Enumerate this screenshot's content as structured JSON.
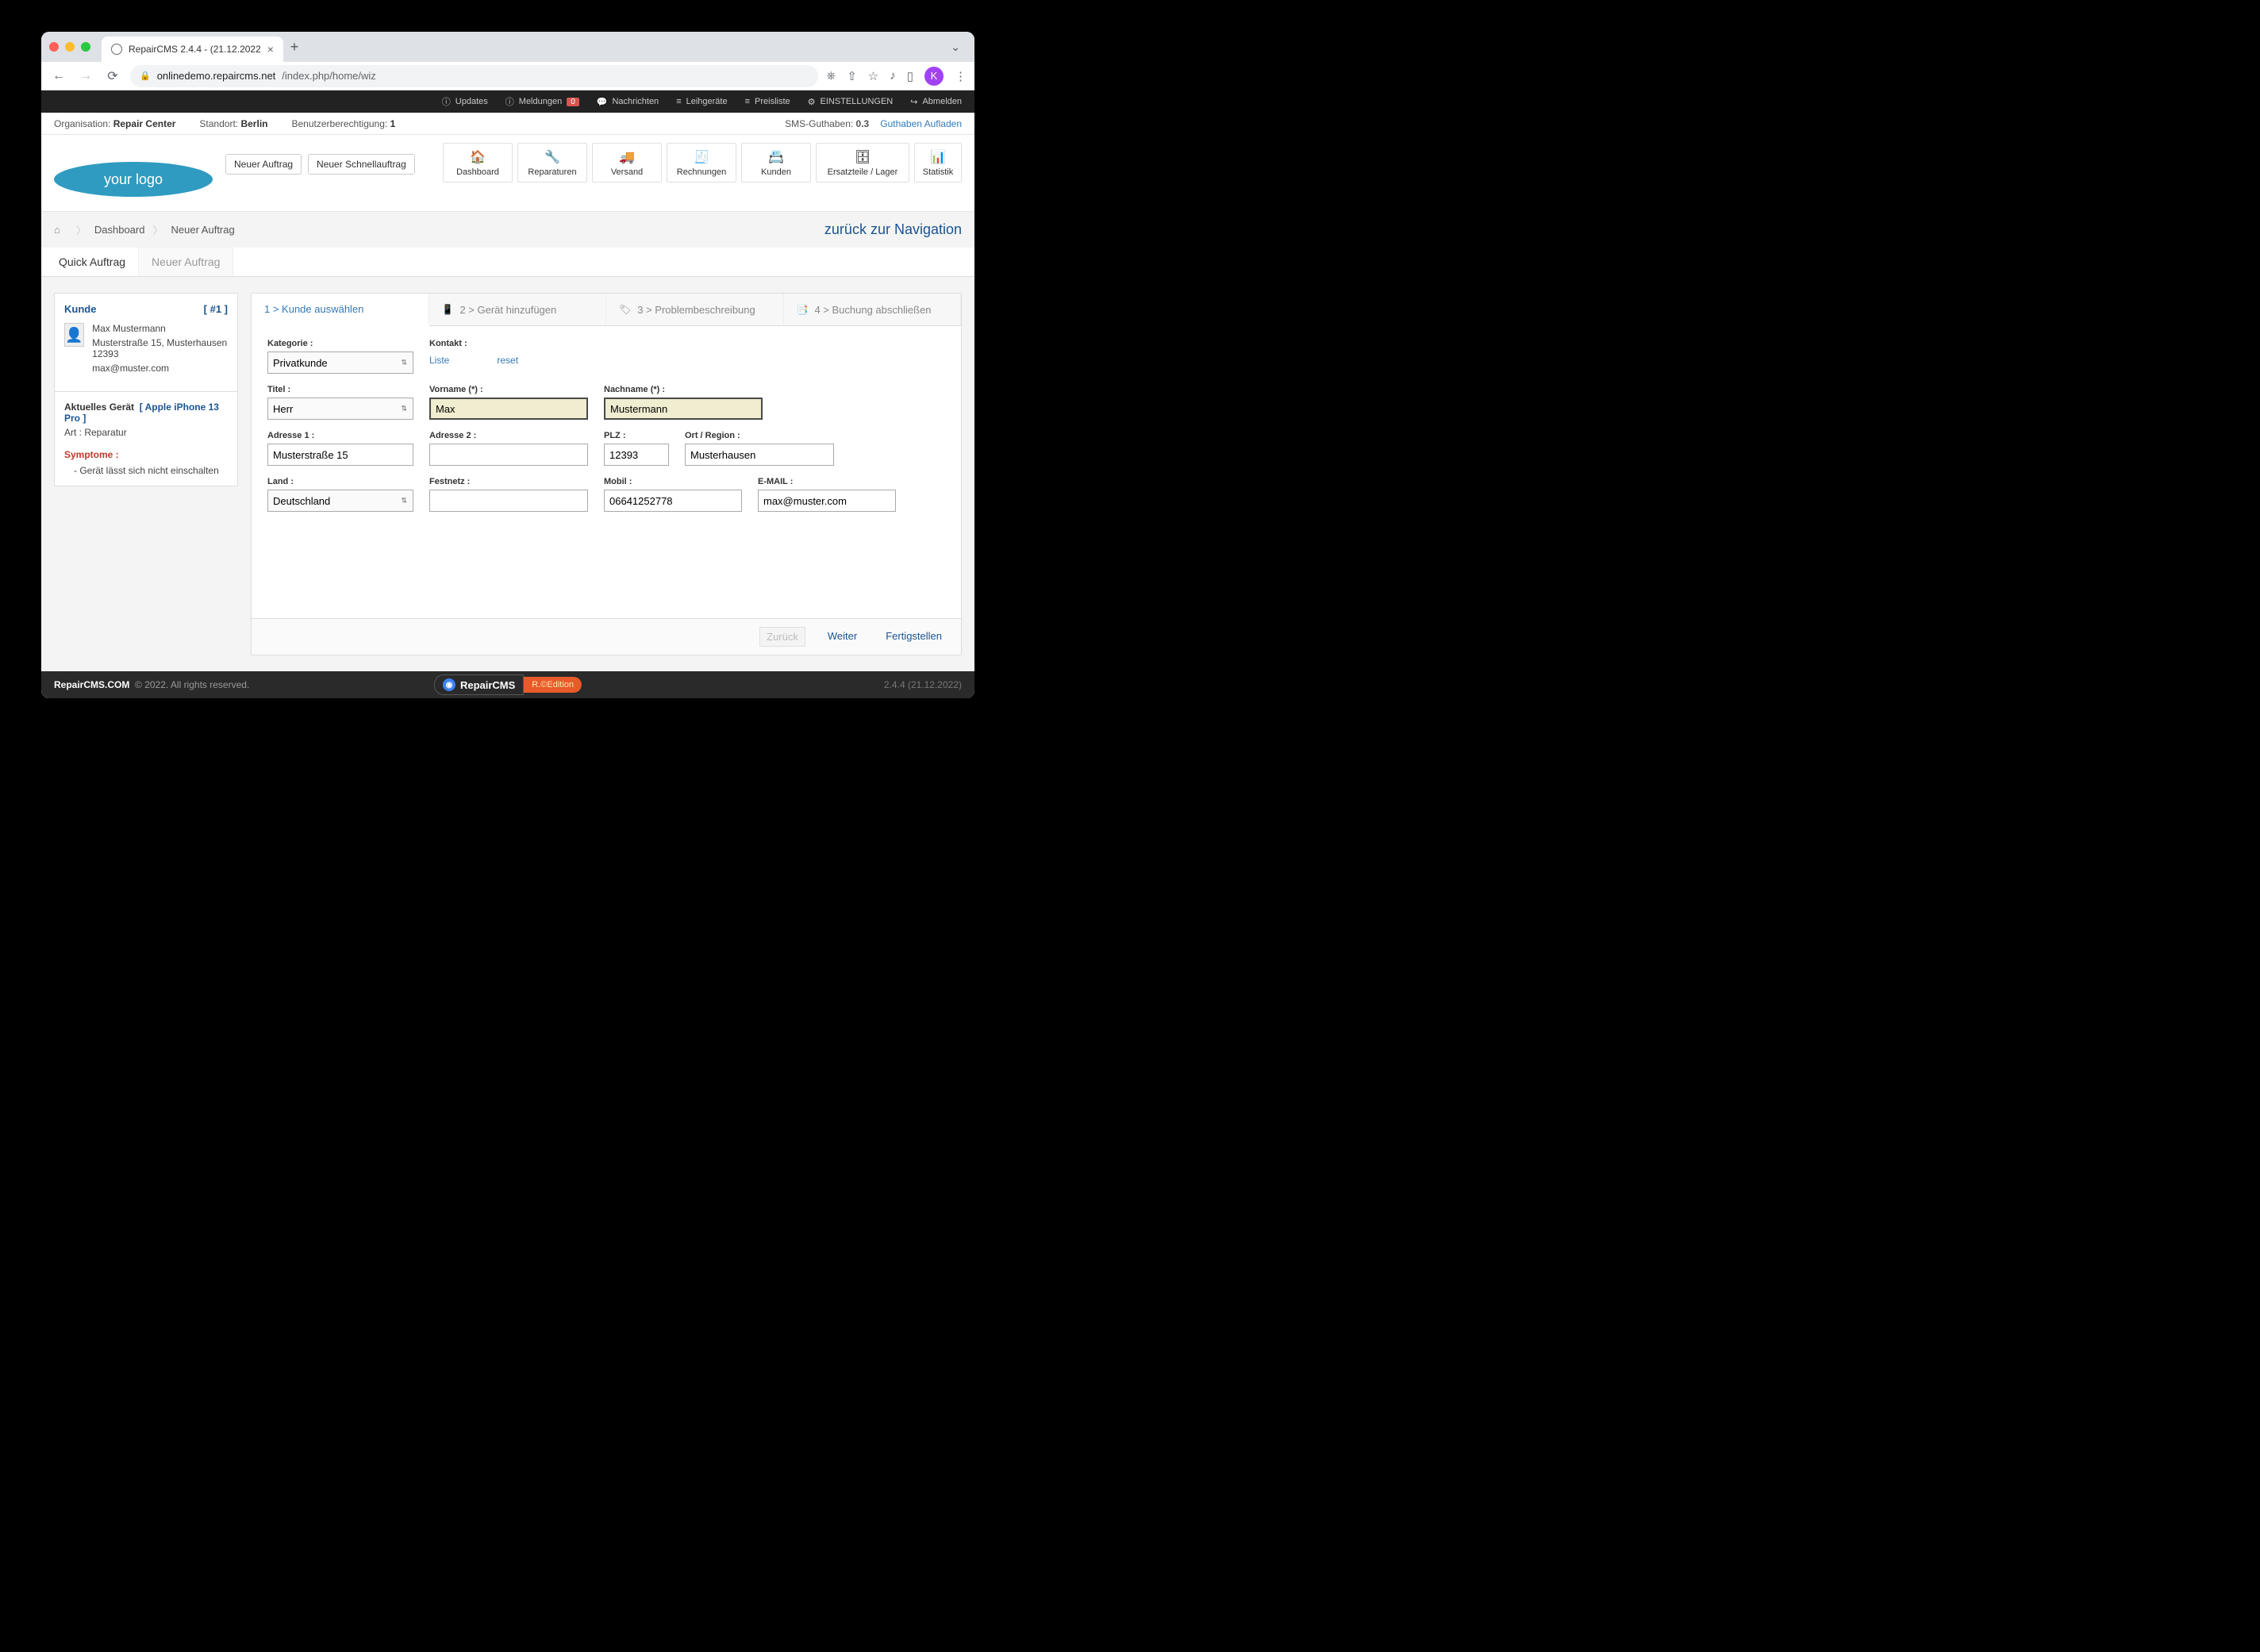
{
  "browser": {
    "tab_title": "RepairCMS 2.4.4 - (21.12.2022",
    "url_domain": "onlinedemo.repaircms.net",
    "url_path": "/index.php/home/wiz",
    "avatar_letter": "K"
  },
  "topbar": {
    "updates": "Updates",
    "meldungen": "Meldungen",
    "meldungen_badge": "0",
    "nachrichten": "Nachrichten",
    "leihgeraete": "Leihgeräte",
    "preisliste": "Preisliste",
    "einstellungen": "EINSTELLUNGEN",
    "abmelden": "Abmelden"
  },
  "infobar": {
    "org_label": "Organisation:",
    "org_value": "Repair Center",
    "loc_label": "Standort:",
    "loc_value": "Berlin",
    "perm_label": "Benutzerberechtigung:",
    "perm_value": "1",
    "sms_label": "SMS-Guthaben:",
    "sms_value": "0.3",
    "topup": "Guthaben Aufladen"
  },
  "header": {
    "logo_text": "your logo",
    "btn_new_order": "Neuer Auftrag",
    "btn_quick_order": "Neuer Schnellauftrag",
    "nav": {
      "dashboard": "Dashboard",
      "reparaturen": "Reparaturen",
      "versand": "Versand",
      "rechnungen": "Rechnungen",
      "kunden": "Kunden",
      "ersatzteile": "Ersatzteile / Lager",
      "statistik": "Statistik"
    }
  },
  "breadcrumb": {
    "dashboard": "Dashboard",
    "current": "Neuer Auftrag",
    "back": "zurück zur Navigation"
  },
  "tabs": {
    "quick": "Quick Auftrag",
    "neu": "Neuer Auftrag"
  },
  "side": {
    "kunde_label": "Kunde",
    "kunde_num": "[ #1 ]",
    "cust_name": "Max Mustermann",
    "cust_addr": "Musterstraße 15, Musterhausen 12393",
    "cust_email": "max@muster.com",
    "device_label": "Aktuelles Gerät",
    "device_name": "[ Apple iPhone 13 Pro ]",
    "device_type": "Art : Reparatur",
    "symptome_label": "Symptome :",
    "symptom_1": "- Gerät lässt sich nicht einschalten"
  },
  "wizard": {
    "step1": "1 > Kunde auswählen",
    "step2": "2 > Gerät hinzufügen",
    "step3": "3 > Problembeschreibung",
    "step4": "4 > Buchung abschließen"
  },
  "form": {
    "kategorie_label": "Kategorie :",
    "kategorie_value": "Privatkunde",
    "kontakt_label": "Kontakt :",
    "kontakt_liste": "Liste",
    "kontakt_reset": "reset",
    "titel_label": "Titel :",
    "titel_value": "Herr",
    "vorname_label": "Vorname (*) :",
    "vorname_value": "Max",
    "nachname_label": "Nachname (*) :",
    "nachname_value": "Mustermann",
    "adresse1_label": "Adresse 1 :",
    "adresse1_value": "Musterstraße 15",
    "adresse2_label": "Adresse 2 :",
    "adresse2_value": "",
    "plz_label": "PLZ :",
    "plz_value": "12393",
    "ort_label": "Ort / Region :",
    "ort_value": "Musterhausen",
    "land_label": "Land :",
    "land_value": "Deutschland",
    "festnetz_label": "Festnetz :",
    "festnetz_value": "",
    "mobil_label": "Mobil :",
    "mobil_value": "06641252778",
    "email_label": "E-MAIL :",
    "email_value": "max@muster.com"
  },
  "wizfooter": {
    "back": "Zurück",
    "next": "Weiter",
    "finish": "Fertigstellen"
  },
  "footer": {
    "brand": "RepairCMS.COM",
    "copy": "© 2022. All rights reserved.",
    "logo_text": "RepairCMS",
    "edition": "R.©Edition",
    "version": "2.4.4 (21.12.2022)"
  }
}
